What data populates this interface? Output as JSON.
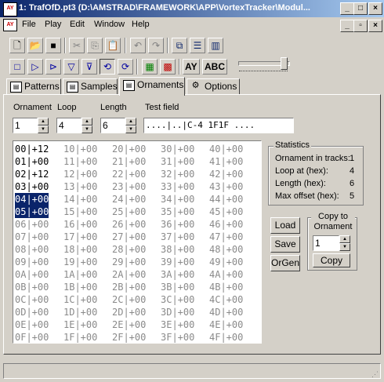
{
  "window": {
    "title": "1: TrafOfD.pt3 (D:\\AMSTRAD\\FRAMEWORK\\APP\\VortexTracker\\Modul...",
    "app_icon_text": "AY"
  },
  "menu": [
    "File",
    "Play",
    "Edit",
    "Window",
    "Help"
  ],
  "toolbar": {
    "ay_label": "AY",
    "abc_label": "ABC"
  },
  "tabs": [
    {
      "label": "Patterns",
      "icon": "pattern-icon"
    },
    {
      "label": "Samples",
      "icon": "sample-icon"
    },
    {
      "label": "Ornaments",
      "icon": "ornament-icon"
    },
    {
      "label": "Options",
      "icon": "options-icon"
    }
  ],
  "active_tab": "Ornaments",
  "fields": {
    "ornament_label": "Ornament",
    "loop_label": "Loop",
    "length_label": "Length",
    "test_label": "Test field",
    "ornament_value": "1",
    "loop_value": "4",
    "length_value": "6",
    "test_value": "....|..|C-4 1F1F ...."
  },
  "ornament_grid": {
    "columns": [
      [
        "00|+12",
        "01|+00",
        "02|+12",
        "03|+00",
        "04|+00",
        "05|+00",
        "06|+00",
        "07|+00",
        "08|+00",
        "09|+00",
        "0A|+00",
        "0B|+00",
        "0C|+00",
        "0D|+00",
        "0E|+00",
        "0F|+00"
      ],
      [
        "10|+00",
        "11|+00",
        "12|+00",
        "13|+00",
        "14|+00",
        "15|+00",
        "16|+00",
        "17|+00",
        "18|+00",
        "19|+00",
        "1A|+00",
        "1B|+00",
        "1C|+00",
        "1D|+00",
        "1E|+00",
        "1F|+00"
      ],
      [
        "20|+00",
        "21|+00",
        "22|+00",
        "23|+00",
        "24|+00",
        "25|+00",
        "26|+00",
        "27|+00",
        "28|+00",
        "29|+00",
        "2A|+00",
        "2B|+00",
        "2C|+00",
        "2D|+00",
        "2E|+00",
        "2F|+00"
      ],
      [
        "30|+00",
        "31|+00",
        "32|+00",
        "33|+00",
        "34|+00",
        "35|+00",
        "36|+00",
        "37|+00",
        "38|+00",
        "39|+00",
        "3A|+00",
        "3B|+00",
        "3C|+00",
        "3D|+00",
        "3E|+00",
        "3F|+00"
      ],
      [
        "40|+00",
        "41|+00",
        "42|+00",
        "43|+00",
        "44|+00",
        "45|+00",
        "46|+00",
        "47|+00",
        "48|+00",
        "49|+00",
        "4A|+00",
        "4B|+00",
        "4C|+00",
        "4D|+00",
        "4E|+00",
        "4F|+00"
      ]
    ],
    "active_length": 6,
    "loop_start": 4
  },
  "statistics": {
    "title": "Statistics",
    "rows": [
      {
        "label": "Ornament in tracks:",
        "value": "1"
      },
      {
        "label": "Loop at (hex):",
        "value": "4"
      },
      {
        "label": "Length (hex):",
        "value": "6"
      },
      {
        "label": "Max offset (hex):",
        "value": "5"
      }
    ]
  },
  "buttons": {
    "load": "Load",
    "save": "Save",
    "orgen": "OrGen",
    "copy": "Copy"
  },
  "copy_group": {
    "title_line1": "Copy to",
    "title_line2": "Ornament",
    "value": "1"
  },
  "colors": {
    "selection": "#0a246a",
    "face": "#d4d0c8"
  }
}
